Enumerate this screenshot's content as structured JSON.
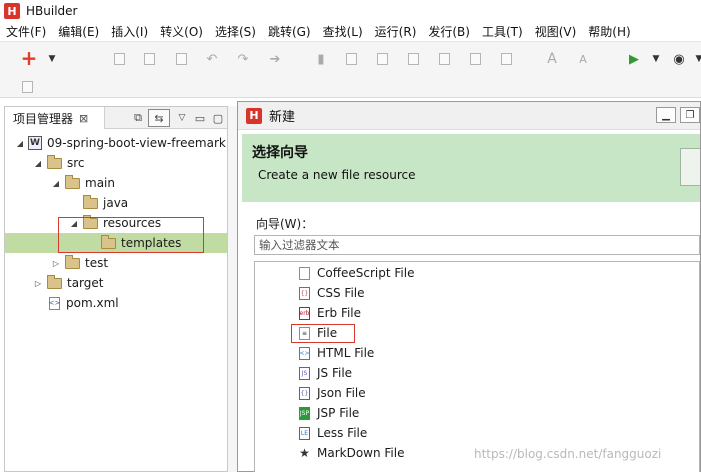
{
  "app": {
    "title": "HBuilder",
    "logo_letter": "H"
  },
  "menu": [
    "文件(F)",
    "编辑(E)",
    "插入(I)",
    "转义(O)",
    "选择(S)",
    "跳转(G)",
    "查找(L)",
    "运行(R)",
    "发行(B)",
    "工具(T)",
    "视图(V)",
    "帮助(H)"
  ],
  "toolbar": {
    "new_icon": "plus-icon",
    "run_icon": "run-icon",
    "browser_icon": "browser-icon"
  },
  "project_panel": {
    "tab_label": "项目管理器",
    "close_glyph": "⊠",
    "tree": [
      {
        "label": "09-spring-boot-view-freemark",
        "kind": "project",
        "twisty": "◢",
        "depth": 0
      },
      {
        "label": "src",
        "kind": "folder",
        "twisty": "◢",
        "depth": 1
      },
      {
        "label": "main",
        "kind": "folder",
        "twisty": "◢",
        "depth": 2
      },
      {
        "label": "java",
        "kind": "folder",
        "twisty": "",
        "depth": 3
      },
      {
        "label": "resources",
        "kind": "folder",
        "twisty": "◢",
        "depth": 3
      },
      {
        "label": "templates",
        "kind": "folder",
        "twisty": "",
        "depth": 4,
        "selected": true
      },
      {
        "label": "test",
        "kind": "folder",
        "twisty": "▷",
        "depth": 2
      },
      {
        "label": "target",
        "kind": "folder",
        "twisty": "▷",
        "depth": 1
      },
      {
        "label": "pom.xml",
        "kind": "xml",
        "twisty": "",
        "depth": 1
      }
    ]
  },
  "dialog": {
    "title": "新建",
    "logo_letter": "H",
    "banner_heading": "选择向导",
    "banner_desc": "Create a new file resource",
    "wizard_label": "向导(W)：",
    "filter_placeholder": "输入过滤器文本",
    "wizards": [
      {
        "label": "CoffeeScript File",
        "icon": "coffee-file-icon"
      },
      {
        "label": "CSS File",
        "icon": "css-file-icon"
      },
      {
        "label": "Erb File",
        "icon": "erb-file-icon"
      },
      {
        "label": "File",
        "icon": "file-icon",
        "highlighted": true
      },
      {
        "label": "HTML File",
        "icon": "html-file-icon"
      },
      {
        "label": "JS File",
        "icon": "js-file-icon"
      },
      {
        "label": "Json File",
        "icon": "json-file-icon"
      },
      {
        "label": "JSP File",
        "icon": "jsp-file-icon"
      },
      {
        "label": "Less File",
        "icon": "less-file-icon"
      },
      {
        "label": "MarkDown File",
        "icon": "star-icon"
      }
    ]
  },
  "watermark": "https://blog.csdn.net/fangguozi",
  "colors": {
    "accent_red": "#d63a2a",
    "selection_green": "#c1dca2",
    "banner_green": "#c7e6c6"
  }
}
